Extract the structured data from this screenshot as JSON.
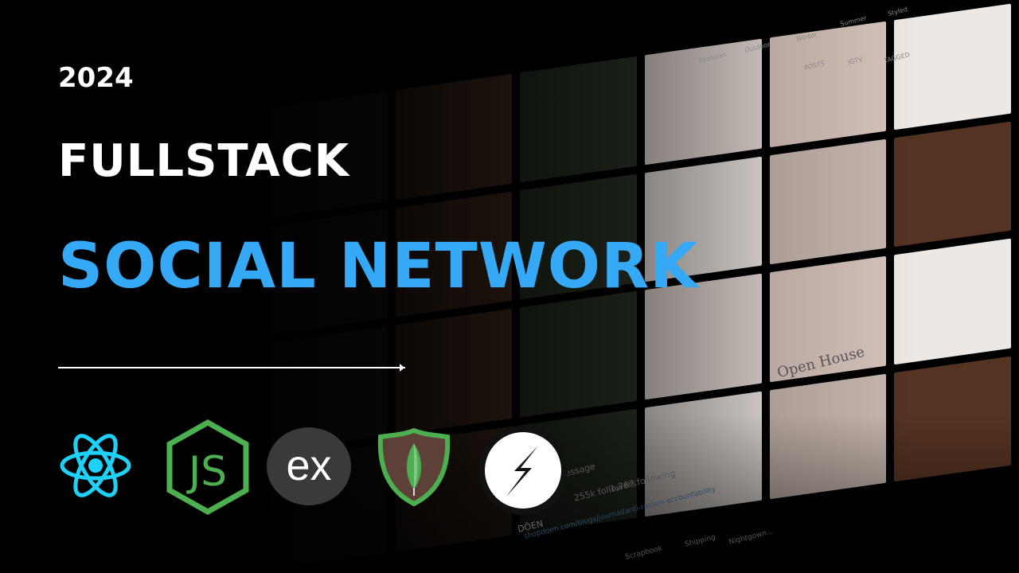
{
  "headline": {
    "year": "2024",
    "line1": "FULLSTACK",
    "line2": "SOCIAL NETWORK"
  },
  "colors": {
    "accent": "#35a9f5",
    "react": "#1fd0f7",
    "node": "#4caf50",
    "mongo_bg": "#5d4037"
  },
  "logos": [
    {
      "name": "react-icon"
    },
    {
      "name": "nodejs-icon",
      "text": "JS"
    },
    {
      "name": "express-icon",
      "text": "ex"
    },
    {
      "name": "mongodb-icon"
    },
    {
      "name": "socketio-icon"
    }
  ],
  "background_profile": {
    "message": "Message",
    "followers": "255k followers",
    "following": "1,787 following",
    "brand": "DÔEN",
    "link": "shopdoen.com/blogs/journal/anti-racism-accountability",
    "highlights": [
      "Scrapbook",
      "Shipping",
      "Nightgown..."
    ],
    "tabs": [
      "POSTS",
      "IGTV",
      "TAGGED"
    ],
    "top_highlights": [
      "Features",
      "Outdoor",
      "Winter",
      "Summer",
      "Styled"
    ],
    "post_text": "Open House"
  }
}
